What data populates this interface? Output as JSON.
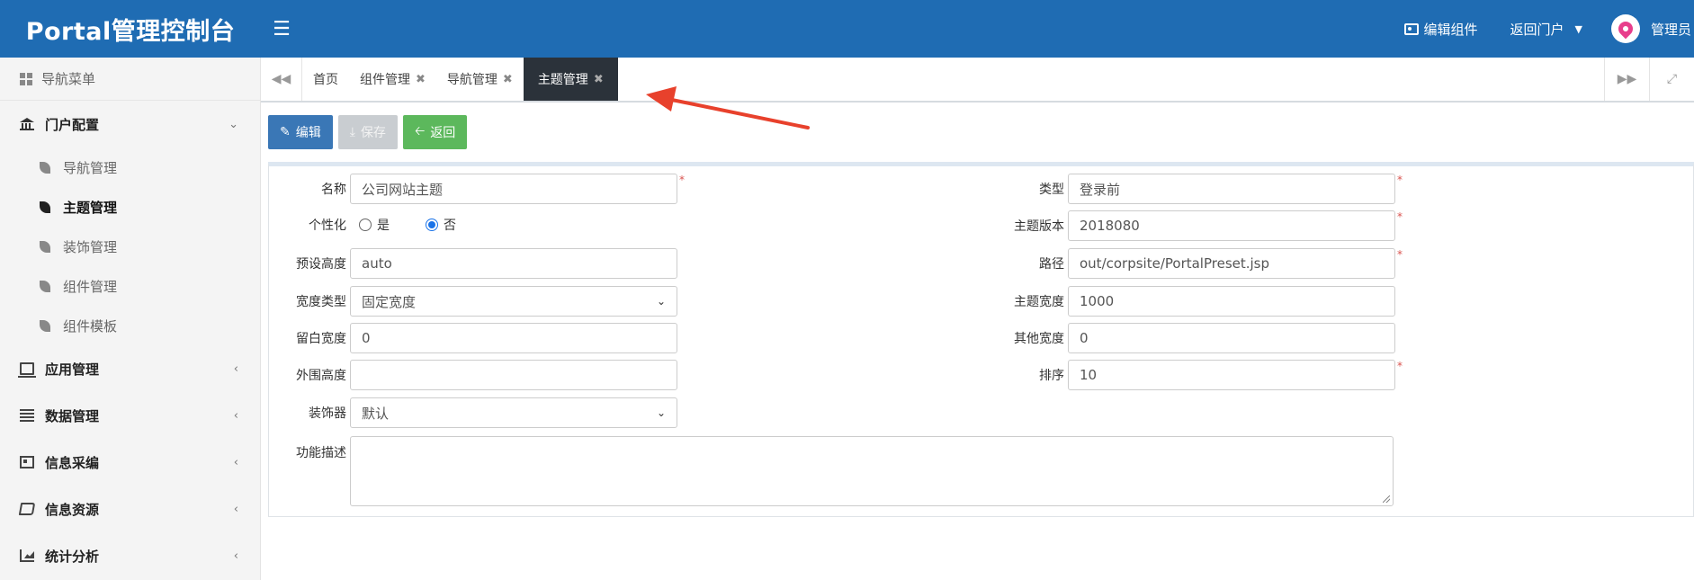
{
  "header": {
    "title": "Portal管理控制台",
    "edit_component": "编辑组件",
    "back_portal": "返回门户",
    "username": "管理员"
  },
  "sidebar": {
    "title": "导航菜单",
    "groups": [
      {
        "label": "门户配置",
        "icon": "bank-icon",
        "expanded": true,
        "items": [
          {
            "label": "导航管理"
          },
          {
            "label": "主题管理",
            "active": true
          },
          {
            "label": "装饰管理"
          },
          {
            "label": "组件管理"
          },
          {
            "label": "组件模板"
          }
        ]
      },
      {
        "label": "应用管理",
        "icon": "laptop-icon"
      },
      {
        "label": "数据管理",
        "icon": "list-icon"
      },
      {
        "label": "信息采编",
        "icon": "card-icon"
      },
      {
        "label": "信息资源",
        "icon": "book-icon"
      },
      {
        "label": "统计分析",
        "icon": "area-chart-icon"
      }
    ]
  },
  "tabs": [
    {
      "label": "首页",
      "closable": false
    },
    {
      "label": "组件管理",
      "closable": true
    },
    {
      "label": "导航管理",
      "closable": true
    },
    {
      "label": "主题管理",
      "closable": true,
      "active": true
    }
  ],
  "toolbar": {
    "edit": "编辑",
    "save": "保存",
    "back": "返回"
  },
  "form": {
    "name_label": "名称",
    "name_value": "公司网站主题",
    "personalize_label": "个性化",
    "personalize_yes": "是",
    "personalize_no": "否",
    "personalize_selected": "否",
    "preset_height_label": "预设高度",
    "preset_height_value": "auto",
    "width_type_label": "宽度类型",
    "width_type_value": "固定宽度",
    "margin_width_label": "留白宽度",
    "margin_width_value": "0",
    "outer_height_label": "外围高度",
    "outer_height_value": "",
    "decorator_label": "装饰器",
    "decorator_value": "默认",
    "description_label": "功能描述",
    "description_value": "",
    "type_label": "类型",
    "type_value": "登录前",
    "theme_version_label": "主题版本",
    "theme_version_value": "2018080",
    "path_label": "路径",
    "path_value": "out/corpsite/PortalPreset.jsp",
    "theme_width_label": "主题宽度",
    "theme_width_value": "1000",
    "other_width_label": "其他宽度",
    "other_width_value": "0",
    "order_label": "排序",
    "order_value": "10",
    "required_mark": "*"
  },
  "colors": {
    "header_bg": "#1f6cb3",
    "active_tab_bg": "#2b323a",
    "edit_btn": "#3a77b6",
    "back_btn": "#5cb85c",
    "required": "#d9534f",
    "annotation_arrow": "#e8412c"
  }
}
